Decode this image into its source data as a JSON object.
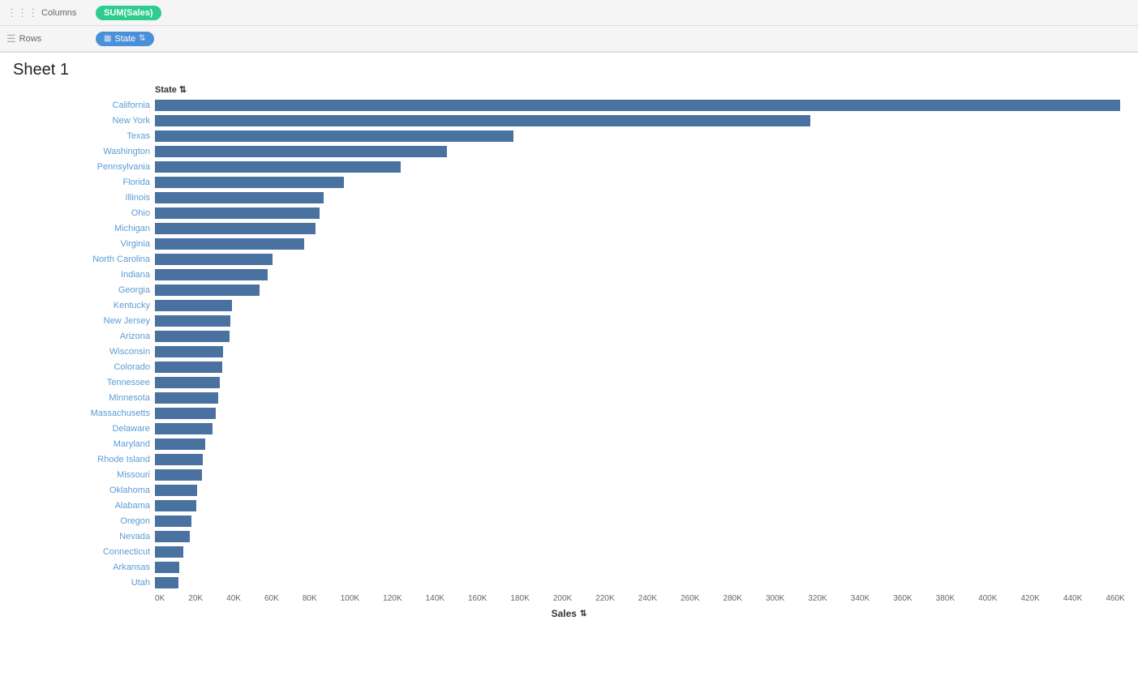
{
  "toolbar": {
    "columns_label": "Columns",
    "rows_label": "Rows",
    "columns_pill": "SUM(Sales)",
    "rows_pill_icon": "▦",
    "rows_pill_text": "State",
    "rows_pill_filter": "≡",
    "columns_dots": "⋮⋮⋮",
    "rows_lines": "☰"
  },
  "sheet": {
    "title": "Sheet 1"
  },
  "chart": {
    "header_state": "State",
    "sort_icon": "≡",
    "x_axis_label": "Sales",
    "x_axis_filter": "≡",
    "x_ticks": [
      "0K",
      "20K",
      "40K",
      "60K",
      "80K",
      "100K",
      "120K",
      "140K",
      "160K",
      "180K",
      "200K",
      "220K",
      "240K",
      "260K",
      "280K",
      "300K",
      "320K",
      "340K",
      "360K",
      "380K",
      "400K",
      "420K",
      "440K",
      "460K"
    ],
    "max_value": 460000,
    "bars": [
      {
        "label": "California",
        "value": 457657
      },
      {
        "label": "New York",
        "value": 310876
      },
      {
        "label": "Texas",
        "value": 170188
      },
      {
        "label": "Washington",
        "value": 138641
      },
      {
        "label": "Pennsylvania",
        "value": 116512
      },
      {
        "label": "Florida",
        "value": 89474
      },
      {
        "label": "Illinois",
        "value": 80166
      },
      {
        "label": "Ohio",
        "value": 78258
      },
      {
        "label": "Michigan",
        "value": 76269
      },
      {
        "label": "Virginia",
        "value": 70636
      },
      {
        "label": "North Carolina",
        "value": 55603
      },
      {
        "label": "Indiana",
        "value": 53540
      },
      {
        "label": "Georgia",
        "value": 49557
      },
      {
        "label": "Kentucky",
        "value": 36591
      },
      {
        "label": "New Jersey",
        "value": 35764
      },
      {
        "label": "Arizona",
        "value": 35283
      },
      {
        "label": "Wisconsin",
        "value": 32125
      },
      {
        "label": "Colorado",
        "value": 32108
      },
      {
        "label": "Tennessee",
        "value": 30662
      },
      {
        "label": "Minnesota",
        "value": 29860
      },
      {
        "label": "Massachusetts",
        "value": 28818
      },
      {
        "label": "Delaware",
        "value": 27453
      },
      {
        "label": "Maryland",
        "value": 23706
      },
      {
        "label": "Rhode Island",
        "value": 22628
      },
      {
        "label": "Missouri",
        "value": 22207
      },
      {
        "label": "Oklahoma",
        "value": 20166
      },
      {
        "label": "Alabama",
        "value": 19512
      },
      {
        "label": "Oregon",
        "value": 17431
      },
      {
        "label": "Nevada",
        "value": 16729
      },
      {
        "label": "Connecticut",
        "value": 13384
      },
      {
        "label": "Arkansas",
        "value": 11678
      },
      {
        "label": "Utah",
        "value": 11220
      }
    ]
  }
}
